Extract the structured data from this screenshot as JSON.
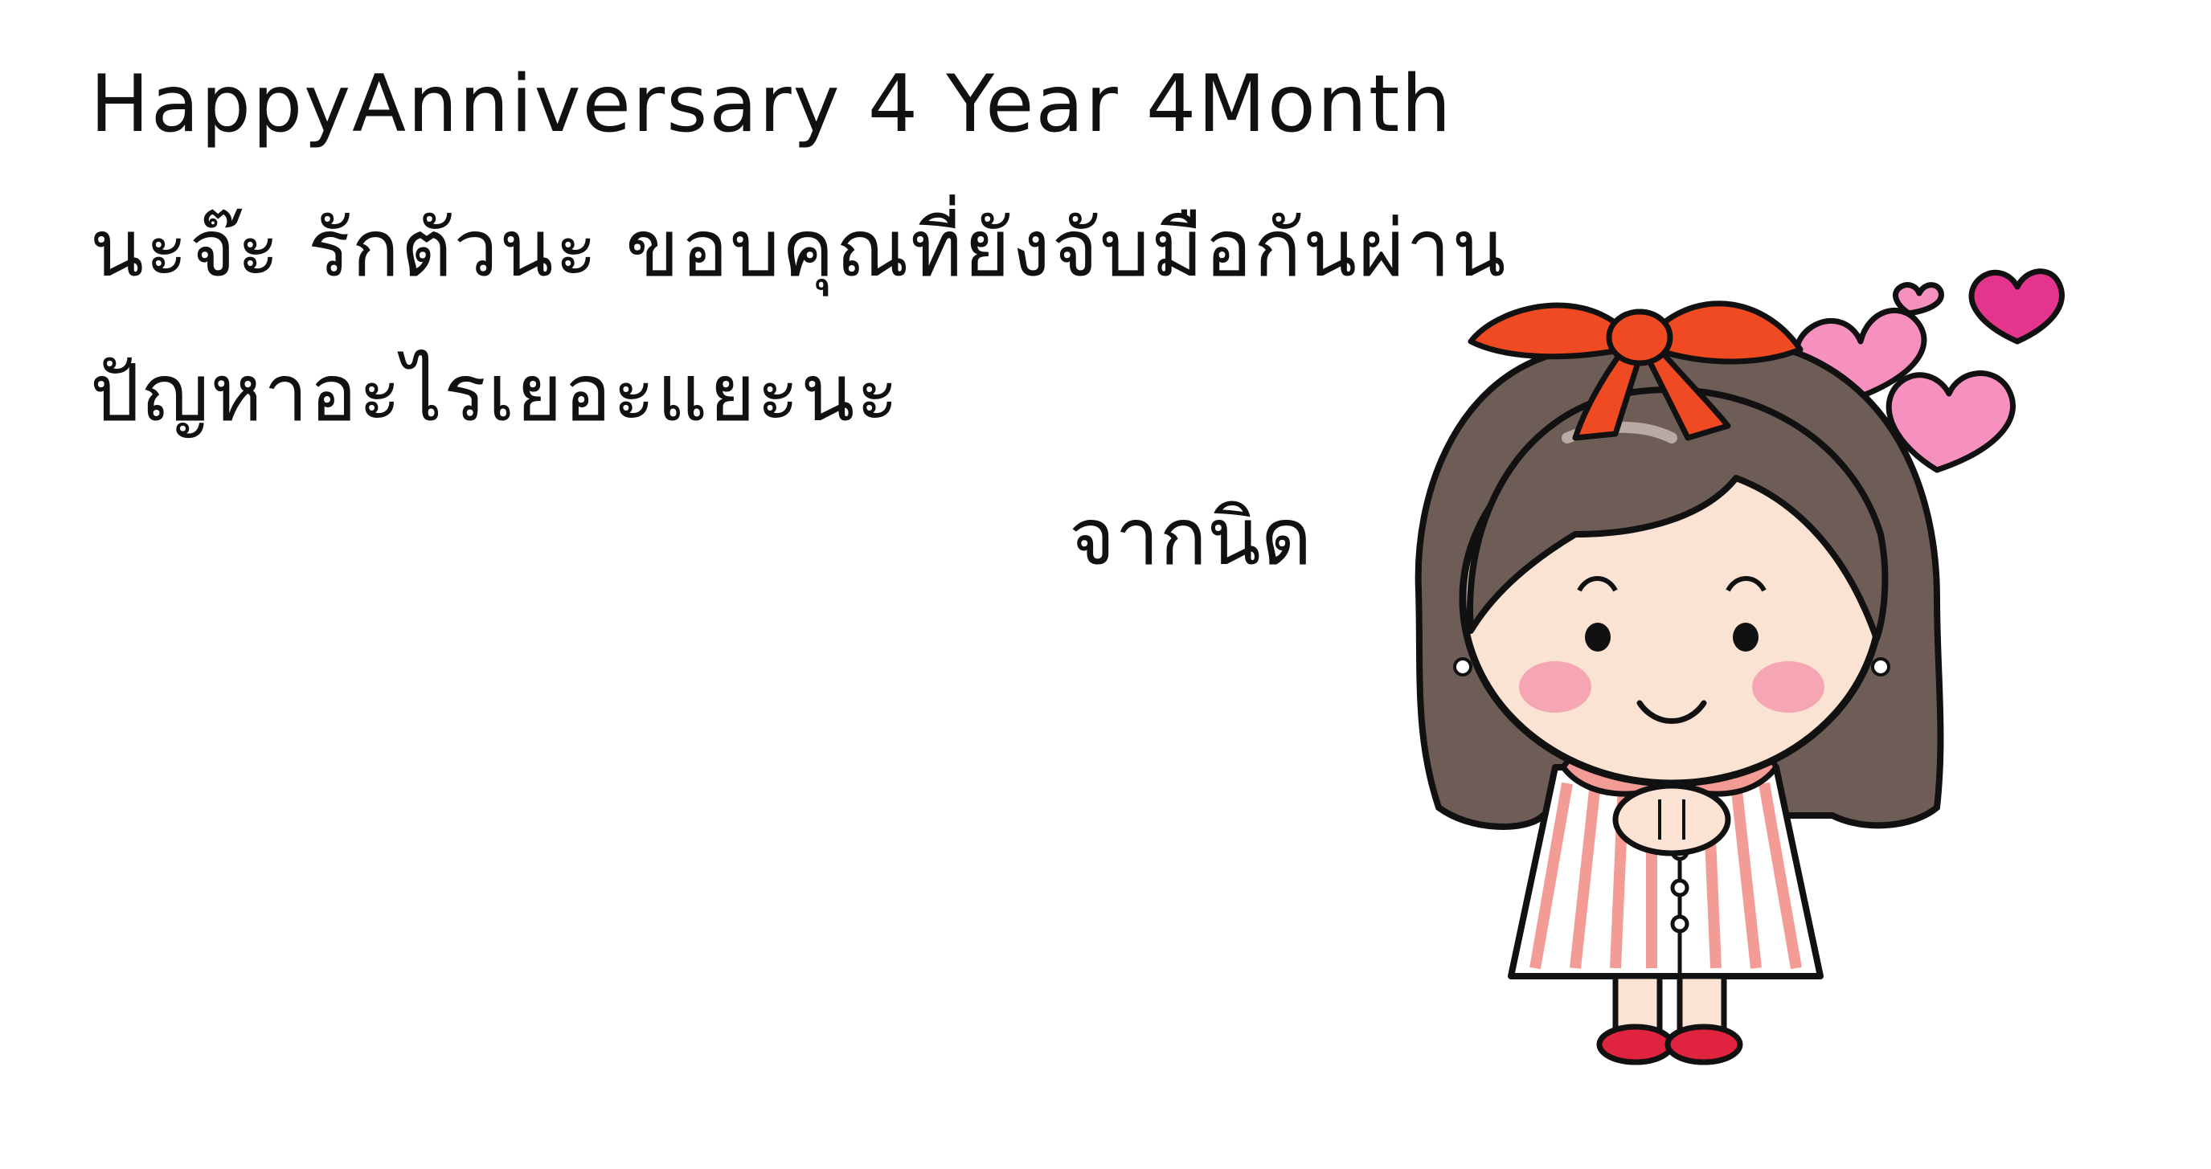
{
  "message": {
    "line1": "HappyAnniversary 4 Year 4Month",
    "line2": "นะจ๊ะ รักตัวนะ ขอบคุณที่ยังจับมือกันผ่าน",
    "line3": "ปัญหาอะไรเยอะแยะนะ"
  },
  "signature": "จากนิด",
  "sticker": {
    "icon": "cartoon-girl-with-hearts-icon",
    "colors": {
      "hair": "#6e5d56",
      "bow": "#f04a22",
      "skin": "#fbe3d3",
      "cheek": "#f5a6b2",
      "heart_pink": "#f690bf",
      "heart_magenta": "#e4358e",
      "dress_stripe": "#f39b95",
      "outline": "#111111"
    }
  }
}
